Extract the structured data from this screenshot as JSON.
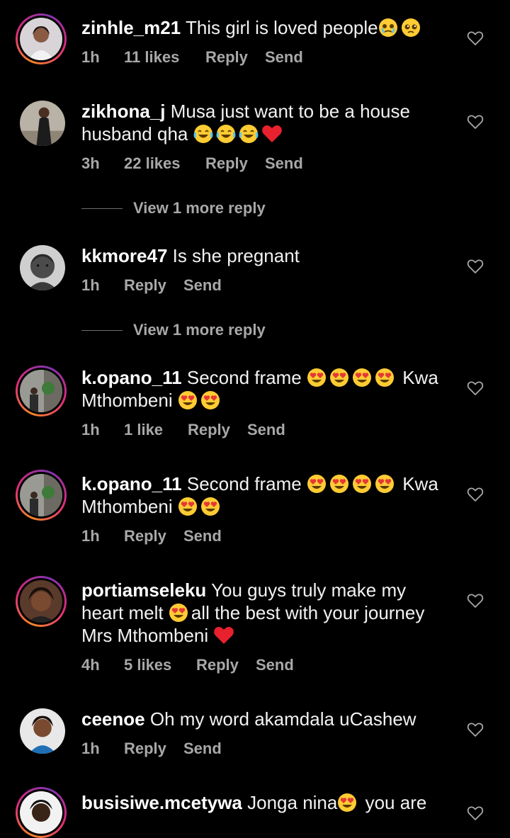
{
  "comments": [
    {
      "username": "zinhle_m21",
      "text": "This girl is loved people",
      "emojis_after": [
        "crying-tears-face",
        "pleading-face"
      ],
      "time": "1h",
      "likes": "11 likes",
      "reply": "Reply",
      "send": "Send"
    },
    {
      "username": "zikhona_j",
      "text_line1": "Musa just want to be a house",
      "text_line2": "husband qha",
      "emojis_after": [
        "tears-of-joy-face",
        "tears-of-joy-face",
        "tears-of-joy-face",
        "red-heart"
      ],
      "time": "3h",
      "likes": "22 likes",
      "reply": "Reply",
      "send": "Send"
    },
    {
      "username": "kkmore47",
      "text": "Is she pregnant",
      "time": "1h",
      "reply": "Reply",
      "send": "Send"
    },
    {
      "username": "k.opano_11",
      "text_line1": "Second frame",
      "text_line1_after": "Kwa",
      "text_line2": "Mthombeni",
      "time": "1h",
      "likes": "1 like",
      "reply": "Reply",
      "send": "Send"
    },
    {
      "username": "k.opano_11",
      "text_line1": "Second frame",
      "text_line1_after": "Kwa",
      "text_line2": "Mthombeni",
      "time": "1h",
      "reply": "Reply",
      "send": "Send"
    },
    {
      "username": "portiamseleku",
      "text_line1": "You guys truly make my",
      "text_line2a": "heart melt",
      "text_line2b": "all the best with your journey",
      "text_line3": "Mrs Mthombeni",
      "time": "4h",
      "likes": "5 likes",
      "reply": "Reply",
      "send": "Send"
    },
    {
      "username": "ceenoe",
      "text": "Oh my word akamdala uCashew",
      "time": "1h",
      "reply": "Reply",
      "send": "Send"
    },
    {
      "username": "busisiwe.mcetywa",
      "text_a": "Jonga nina",
      "text_b": "you are"
    }
  ],
  "view_more_replies": [
    {
      "label": "View 1 more reply"
    },
    {
      "label": "View 1 more reply"
    }
  ],
  "icons": {
    "like": "heart-outline-icon"
  },
  "colors": {
    "background": "#000000",
    "text": "#f2f2f2",
    "meta": "#a8a8a8",
    "story_ring_start": "#f58529",
    "story_ring_mid": "#dd2a7b",
    "story_ring_end": "#8134af"
  }
}
